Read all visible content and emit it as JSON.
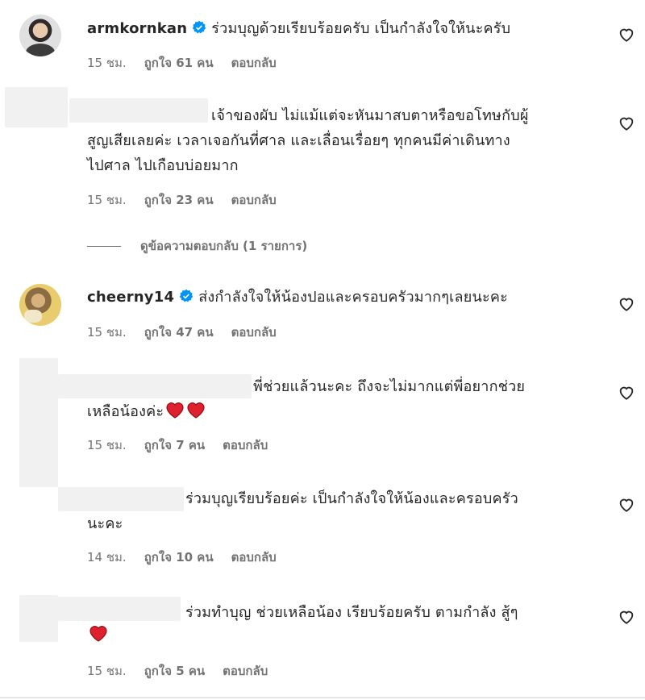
{
  "comments": [
    {
      "username": "armkornkan",
      "verified": true,
      "lines": [
        "ร่วมบุญด้วยเรียบร้อยครับ เป็นกำลังใจให้นะครับ"
      ],
      "time": "15 ชม.",
      "likes": "ถูกใจ 61 คน",
      "reply": "ตอบกลับ"
    },
    {
      "username": "",
      "verified": false,
      "lines": [
        "เจ้าของผับ ไม่แม้แต่จะหันมาสบตาหรือขอโทษกับผู้",
        "สูญเสียเลยค่ะ เวลาเจอกันที่ศาล และเลื่อนเรื่อยๆ ทุกคนมีค่าเดินทาง",
        "ไปศาล ไปเกือบบ่อยมาก"
      ],
      "time": "15 ชม.",
      "likes": "ถูกใจ 23 คน",
      "reply": "ตอบกลับ",
      "view_replies": "ดูข้อความตอบกลับ (1 รายการ)"
    },
    {
      "username": "cheerny14",
      "verified": true,
      "lines": [
        "ส่งกำลังใจให้น้องปอและครอบครัวมากๆเลยนะคะ"
      ],
      "time": "15 ชม.",
      "likes": "ถูกใจ 47 คน",
      "reply": "ตอบกลับ"
    },
    {
      "username": "",
      "verified": false,
      "lines": [
        "พี่ช่วยแล้วนะคะ ถึงจะไม่มากแต่พี่อยากช่วย",
        "เหลือน้องค่ะ"
      ],
      "time": "15 ชม.",
      "likes": "ถูกใจ 7 คน",
      "reply": "ตอบกลับ"
    },
    {
      "username": "",
      "verified": false,
      "lines": [
        "ร่วมบุญเรียบร้อยค่ะ เป็นกำลังใจให้น้องและครอบครัว",
        "นะคะ"
      ],
      "time": "14 ชม.",
      "likes": "ถูกใจ 10 คน",
      "reply": "ตอบกลับ"
    },
    {
      "username": "",
      "verified": false,
      "lines": [
        "ร่วมทำบุญ ช่วยเหลือน้อง เรียบร้อยครับ ตามกำลัง สู้ๆ"
      ],
      "time": "15 ชม.",
      "likes": "ถูกใจ 5 คน",
      "reply": "ตอบกลับ"
    }
  ],
  "icons": {
    "verified": "verified-badge-icon",
    "like": "heart-outline-icon",
    "emoji": "red-heart-emoji-icon"
  },
  "colors": {
    "verified_blue": "#0095f6",
    "emoji_red": "#e0202f",
    "meta_gray": "#737373"
  }
}
